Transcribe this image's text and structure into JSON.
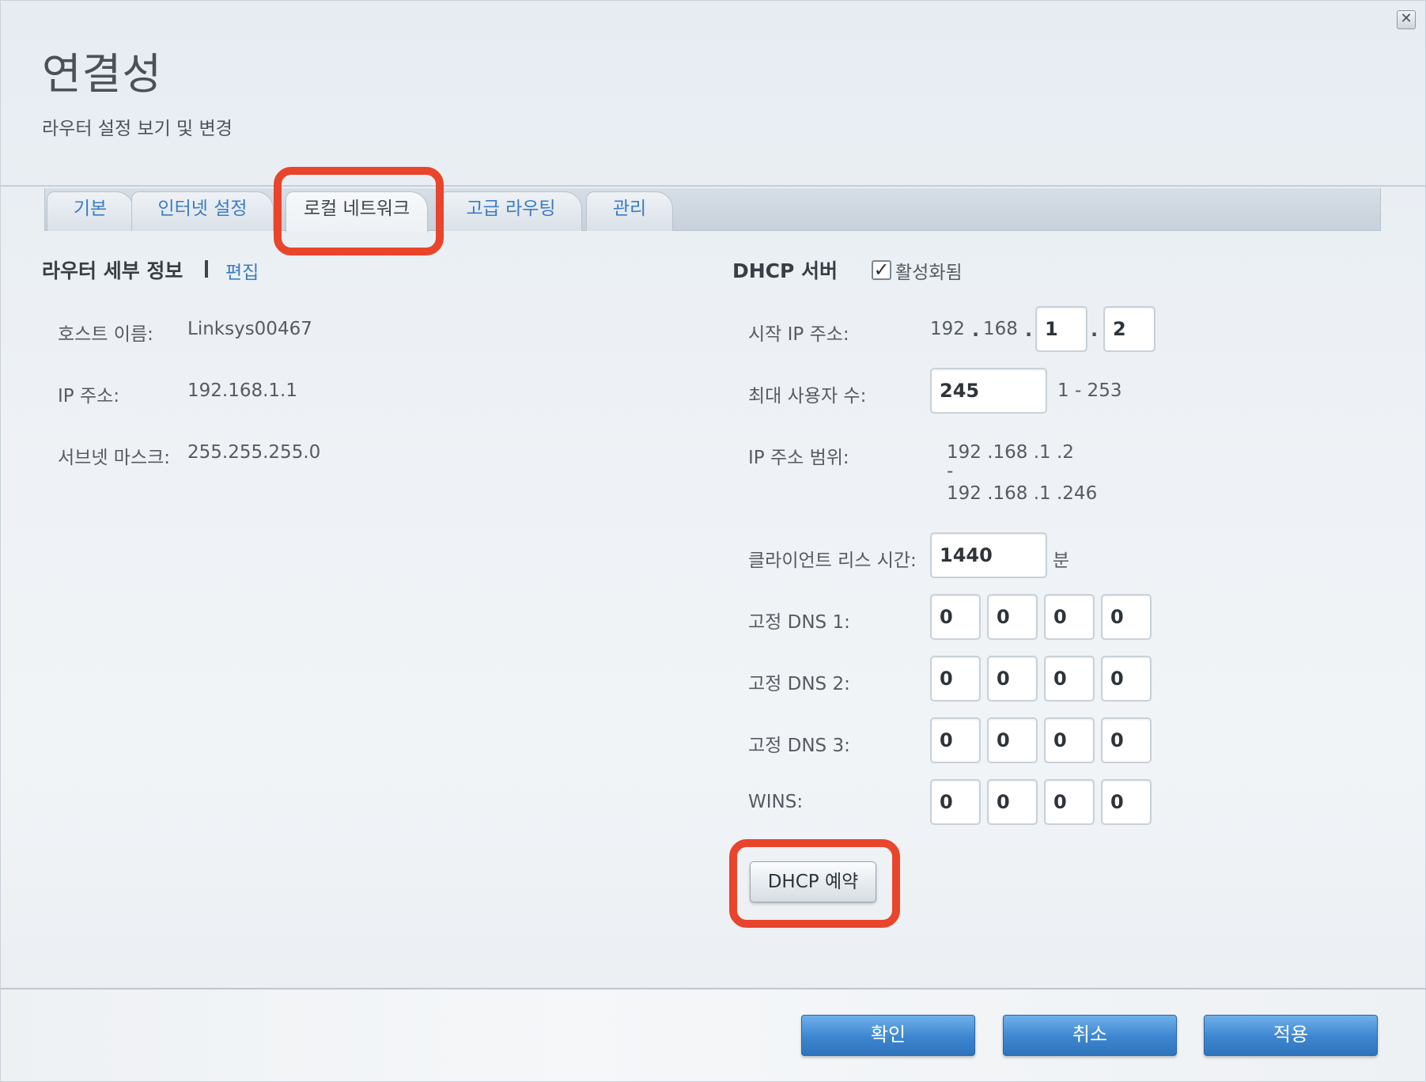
{
  "header": {
    "title": "연결성",
    "subtitle": "라우터 설정 보기 및 변경",
    "close_icon": "close-icon"
  },
  "tabs": [
    {
      "label": "기본"
    },
    {
      "label": "인터넷 설정"
    },
    {
      "label": "로컬 네트워크",
      "active": true
    },
    {
      "label": "고급 라우팅"
    },
    {
      "label": "관리"
    }
  ],
  "router_details": {
    "title": "라우터 세부 정보",
    "edit_label": "편집",
    "host_name_label": "호스트 이름:",
    "host_name": "Linksys00467",
    "ip_label": "IP 주소:",
    "ip": "192.168.1.1",
    "subnet_label": "서브넷 마스크:",
    "subnet": "255.255.255.0"
  },
  "dhcp": {
    "title": "DHCP 서버",
    "enabled_label": "활성화됨",
    "enabled": true,
    "start_ip_label": "시작 IP 주소:",
    "start_ip_fixed": [
      "192",
      "168"
    ],
    "start_ip_3": "1",
    "start_ip_4": "2",
    "max_users_label": "최대 사용자 수:",
    "max_users": "245",
    "max_users_range": "1 - 253",
    "range_label": "IP 주소 범위:",
    "range_start": "192 .168 .1 .2",
    "range_dash": "-",
    "range_end": "192 .168 .1 .246",
    "lease_label": "클라이언트 리스 시간:",
    "lease": "1440",
    "lease_unit": "분",
    "dns1_label": "고정 DNS 1:",
    "dns1": [
      "0",
      "0",
      "0",
      "0"
    ],
    "dns2_label": "고정 DNS 2:",
    "dns2": [
      "0",
      "0",
      "0",
      "0"
    ],
    "dns3_label": "고정 DNS 3:",
    "dns3": [
      "0",
      "0",
      "0",
      "0"
    ],
    "wins_label": "WINS:",
    "wins": [
      "0",
      "0",
      "0",
      "0"
    ],
    "reservation_button": "DHCP 예약"
  },
  "footer": {
    "ok": "확인",
    "cancel": "취소",
    "apply": "적용"
  },
  "colors": {
    "highlight": "#e8452c",
    "link": "#3b7cc1",
    "primary_button": "#3d86cf"
  }
}
